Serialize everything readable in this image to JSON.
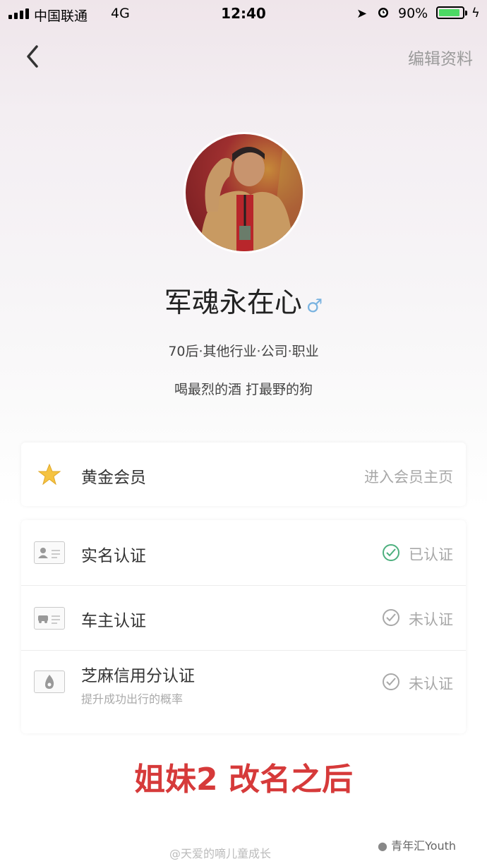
{
  "status_bar": {
    "carrier": "中国联通",
    "network": "4G",
    "time": "12:40",
    "battery": "90%"
  },
  "nav": {
    "back_icon": "chevron-left-icon",
    "edit_label": "编辑资料"
  },
  "profile": {
    "name": "军魂永在心",
    "gender_symbol": "♂",
    "info": "70后·其他行业·公司·职业",
    "motto": "喝最烈的酒 打最野的狗"
  },
  "member": {
    "label": "黄金会员",
    "action": "进入会员主页",
    "icon": "star-icon",
    "accent": "#f5c342"
  },
  "verifications": [
    {
      "label": "实名认证",
      "status": "已认证",
      "icon": "id-card-icon"
    },
    {
      "label": "车主认证",
      "status": "未认证",
      "icon": "car-card-icon"
    },
    {
      "label": "芝麻信用分认证",
      "status": "未认证",
      "sub": "提升成功出行的概率",
      "icon": "sesame-credit-icon"
    }
  ],
  "caption": "姐妹2 改名之后",
  "watermark": {
    "left": "@天爱的嘀儿童成长",
    "right": "青年汇Youth"
  }
}
